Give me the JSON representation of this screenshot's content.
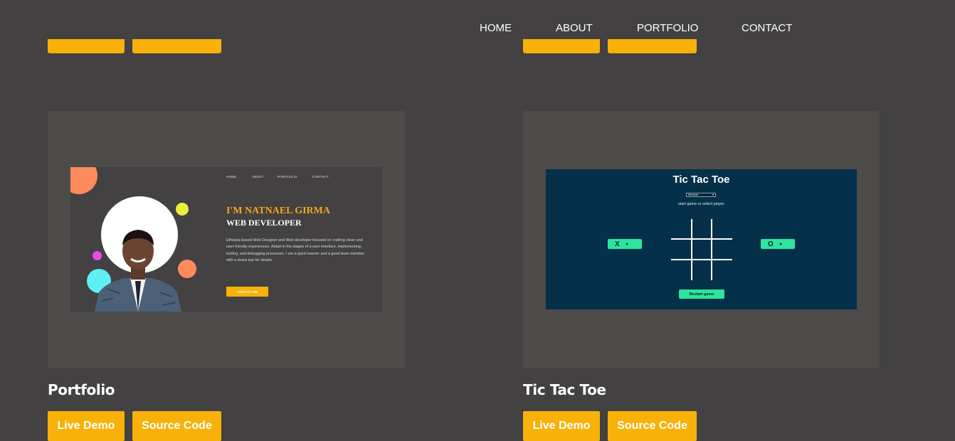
{
  "nav": {
    "items": [
      "HOME",
      "ABOUT",
      "PORTFOLIO",
      "CONTACT"
    ]
  },
  "projects": [
    {
      "title": "Portfolio",
      "live_label": "Live Demo",
      "source_label": "Source Code",
      "preview": {
        "nav": [
          "HOME",
          "ABOUT",
          "PORTFOLIO",
          "CONTACT"
        ],
        "name": "I'M NATNAEL GIRMA",
        "role": "WEB DEVELOPER",
        "description": "Ethiopia-based Web Designer and Web developer focused on crafting clean and user-friendly experiences. Adapt in the stages of a user interface, implementing, testing, and debugging processes. I am a quick learner and a good team member with a sharp eye for details.",
        "cta": "CONTACT ME"
      }
    },
    {
      "title": "Tic Tac Toe",
      "live_label": "Live Demo",
      "source_label": "Source Code",
      "preview": {
        "title": "Tic Tac Toe",
        "select_value": "Medium",
        "subtitle": "start game or select player",
        "player_x": "X",
        "player_o": "O",
        "restart": "Restart game"
      }
    }
  ],
  "colors": {
    "background": "#434141",
    "card": "#4d4a4a",
    "accent": "#f7b108",
    "ttt_bg": "#04304a",
    "ttt_green": "#2ee59d"
  }
}
